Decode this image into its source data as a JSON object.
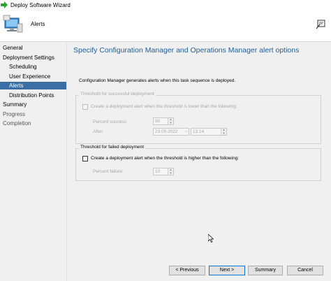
{
  "window": {
    "title": "Deploy Software Wizard"
  },
  "header": {
    "page_name": "Alerts"
  },
  "sidebar": {
    "items": [
      {
        "label": "General"
      },
      {
        "label": "Deployment Settings"
      },
      {
        "label": "Scheduling"
      },
      {
        "label": "User Experience"
      },
      {
        "label": "Alerts"
      },
      {
        "label": "Distribution Points"
      },
      {
        "label": "Summary"
      },
      {
        "label": "Progress"
      },
      {
        "label": "Completion"
      }
    ]
  },
  "content": {
    "title": "Specify Configuration Manager and Operations Manager alert options",
    "description": "Configuration Manager generates alerts when this task sequence is deployed.",
    "success_group": {
      "label": "Threshold for successful deployment",
      "checkbox_label": "Create a deployment alert when the threshold is lower than the following:",
      "checked": false,
      "percent_label": "Percent success:",
      "percent_value": "90",
      "after_label": "After:",
      "date_value": "23.09.2022",
      "time_value": "13:14"
    },
    "failure_group": {
      "label": "Threshold for failed deployment",
      "checkbox_label": "Create a deployment alert when the threshold is higher than the following:",
      "checked": false,
      "percent_label": "Percent failure:",
      "percent_value": "10"
    }
  },
  "buttons": {
    "previous": "< Previous",
    "next": "Next >",
    "summary": "Summary",
    "cancel": "Cancel"
  },
  "colors": {
    "accent_title": "#1f5fa0",
    "selection": "#3a6ea5",
    "green_arrow": "#2aa52a"
  }
}
